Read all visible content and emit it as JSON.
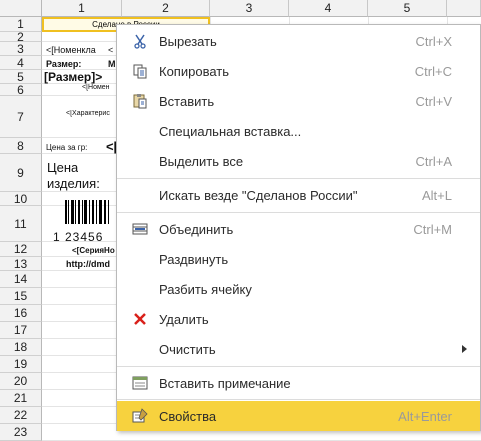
{
  "columns": [
    "1",
    "2",
    "3",
    "4",
    "5"
  ],
  "rows": [
    "1",
    "2",
    "3",
    "4",
    "5",
    "6",
    "7",
    "8",
    "9",
    "10",
    "11",
    "12",
    "13",
    "14",
    "15",
    "16",
    "17",
    "18",
    "19",
    "20",
    "21",
    "22",
    "23"
  ],
  "cells": {
    "r1": "Сделано в России",
    "r3a": "<[Номенкла",
    "r3b": "<",
    "r4a": "Размер:",
    "r4b": "М",
    "r5": "[Размер]>",
    "r6": "<[Номен",
    "r7": "<[Характерис",
    "r8a": "Цена за гр:",
    "r8b": "<[",
    "r9a": "Цена",
    "r9b": "изделия:",
    "r11": "1 23456",
    "r12": "<[СерияНо",
    "r13": "http://dmd"
  },
  "context_menu": {
    "items": [
      {
        "label": "Вырезать",
        "shortcut": "Ctrl+X",
        "icon": "scissors-icon"
      },
      {
        "label": "Копировать",
        "shortcut": "Ctrl+C",
        "icon": "copy-icon"
      },
      {
        "label": "Вставить",
        "shortcut": "Ctrl+V",
        "icon": "paste-icon"
      },
      {
        "label": "Специальная вставка...",
        "shortcut": ""
      },
      {
        "label": "Выделить все",
        "shortcut": "Ctrl+A"
      },
      {
        "label": "Искать везде \"Сделанов России\"",
        "shortcut": "Alt+L"
      },
      {
        "label": "Объединить",
        "shortcut": "Ctrl+M",
        "icon": "merge-cells-icon"
      },
      {
        "label": "Раздвинуть",
        "shortcut": ""
      },
      {
        "label": "Разбить ячейку",
        "shortcut": ""
      },
      {
        "label": "Удалить",
        "shortcut": "",
        "icon": "delete-icon"
      },
      {
        "label": "Очистить",
        "shortcut": "",
        "submenu": true
      },
      {
        "label": "Вставить примечание",
        "shortcut": "",
        "icon": "note-icon"
      },
      {
        "label": "Свойства",
        "shortcut": "Alt+Enter",
        "icon": "properties-icon",
        "highlighted": true
      }
    ]
  },
  "colors": {
    "highlight": "#f7d23e",
    "delete_icon": "#d9201a",
    "selection_border": "#f0c020"
  }
}
